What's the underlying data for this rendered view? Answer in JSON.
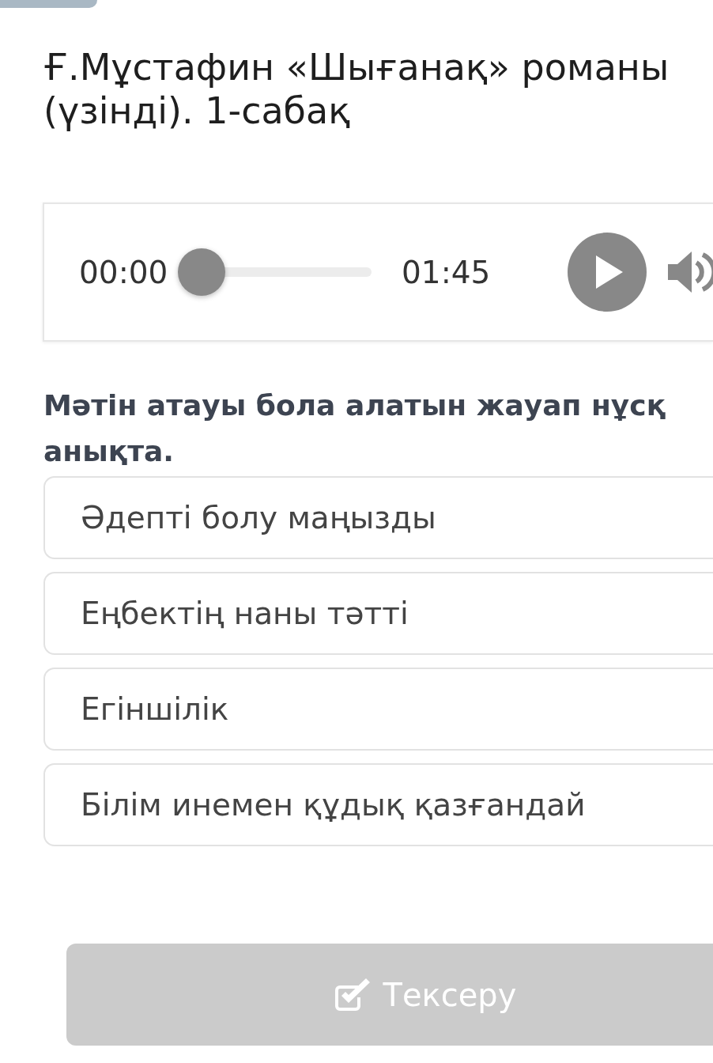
{
  "header": {
    "title": "Ғ.Мұстафин «Шығанақ» романы\n(үзінді). 1-сабақ"
  },
  "audio_player": {
    "current_time": "00:00",
    "duration": "01:45",
    "level": 0,
    "playing": false
  },
  "question": {
    "text": "Мәтін атауы бола алатын жауап нұсқ\nанықта."
  },
  "options": [
    {
      "label": "Әдепті болу маңызды",
      "selected": false
    },
    {
      "label": "Еңбектің наны тәтті",
      "selected": false
    },
    {
      "label": "Егіншілік",
      "selected": false
    },
    {
      "label": "Білім инемен құдық қазғандай",
      "selected": false
    }
  ],
  "check_button": {
    "label": "Тексеру",
    "disabled": true
  }
}
